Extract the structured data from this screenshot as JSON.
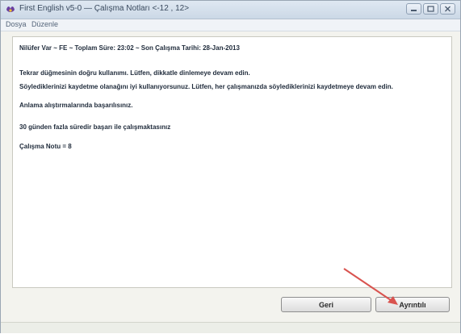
{
  "window": {
    "title": "First English v5-0  —  Çalışma Notları <-12 , 12>"
  },
  "menu": {
    "items": [
      "Dosya",
      "Düzenle"
    ]
  },
  "report": {
    "header": "Nilüfer Var  ~  FE  ~  Toplam Süre: 23:02  ~  Son Çalışma Tarihi: 28-Jan-2013",
    "lines": [
      "Tekrar düğmesinin doğru kullanımı. Lütfen, dikkatle dinlemeye devam edin.",
      "Söylediklerinizi kaydetme olanağını iyi kullanıyorsunuz. Lütfen, her çalışmanızda söylediklerinizi kaydetmeye devam edin.",
      "Anlama alıştırmalarında başarılısınız.",
      "30 günden fazla süredir başarı ile çalışmaktasınız",
      "Çalışma Notu = 8"
    ]
  },
  "buttons": {
    "back": "Geri",
    "details": "Ayrıntılı"
  },
  "colors": {
    "annotation_arrow": "#d9534f"
  }
}
